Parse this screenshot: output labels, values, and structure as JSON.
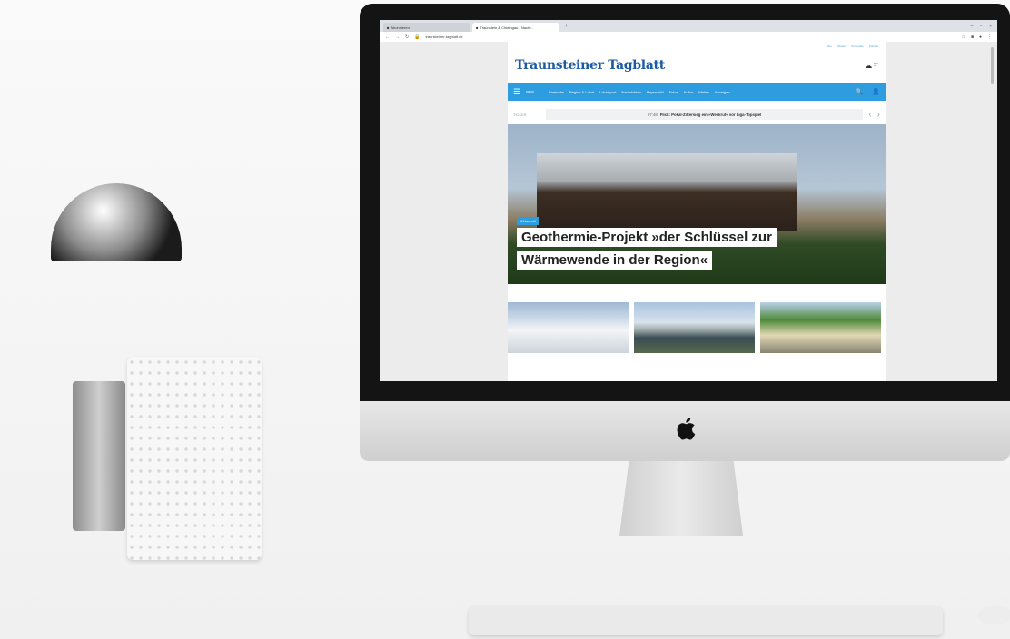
{
  "browser": {
    "tabs": [
      {
        "label": "Abonnieren",
        "active": false
      },
      {
        "label": "Traunstein & Chiemgau - Nachr...",
        "active": true
      }
    ],
    "url": "traunsteiner-tagblatt.de"
  },
  "site": {
    "top_links": [
      "Abo",
      "ePaper",
      "Prospekte",
      "Kontakt"
    ],
    "logo": "Traunsteiner Tagblatt",
    "weather_temp": "5°",
    "menu_label": "MENÜ",
    "nav": [
      "Startseite",
      "Region & Lokal",
      "Lokalsport",
      "Nachrichten",
      "Bayernbild",
      "Fotos",
      "Kultur",
      "Wetter",
      "Anzeigen"
    ],
    "ticker_label": "TICKER",
    "ticker_time": "07:48",
    "ticker_text": "Flick: Pokal-Zittersieg ein »Weckruf« vor Liga-Topspiel",
    "hero_badge": "Wirtschaft",
    "hero_line1": "Geothermie-Projekt »der Schlüssel zur",
    "hero_line2": "Wärmewende in der Region«"
  },
  "colors": {
    "nav_blue": "#2d9de0",
    "logo_blue": "#1b5aa5"
  }
}
